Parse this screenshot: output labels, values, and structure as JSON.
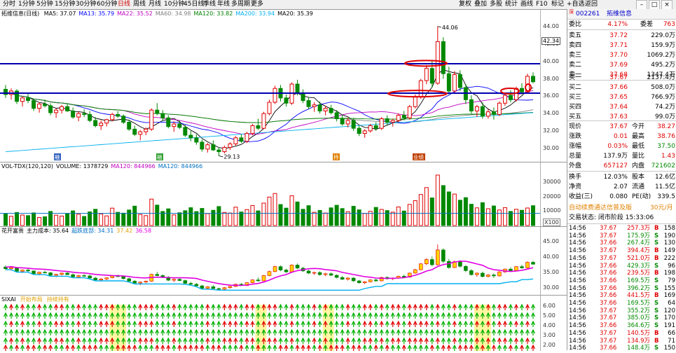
{
  "toolbar": {
    "periods": [
      "分时",
      "1分钟",
      "5分钟",
      "15分钟",
      "30分钟",
      "60分钟",
      "日线",
      "周线",
      "月线",
      "10分钟",
      "45日线",
      "季线",
      "年线",
      "多周期",
      "更多"
    ],
    "active_index": 6,
    "right_buttons": [
      "复权",
      "叠加",
      "多股",
      "统计",
      "画线",
      "F10",
      "标记",
      "+自选",
      "返回"
    ]
  },
  "kline": {
    "title": "拓维信息(日线)",
    "ma_labels": [
      "MA5: 37.07",
      "MA13: 35.79",
      "MA22: 35.52",
      "MA60: 34.98",
      "MA120: 33.82",
      "MA200: 33.94",
      "MA20: 35.39"
    ],
    "ma_colors": [
      "#000000",
      "#0000ff",
      "#c000c0",
      "#808080",
      "#008000",
      "#00b0f0",
      "#000000"
    ],
    "y_ticks": [
      "44.00",
      "42.00",
      "40.00",
      "38.00",
      "36.00",
      "34.00",
      "32.00",
      "30.00"
    ],
    "current_price_box": "42.34",
    "high_annotation": "44.06",
    "low_annotation": "29.13",
    "event_labels": [
      "融",
      "融",
      "持",
      "业绩"
    ]
  },
  "volume": {
    "title_items": [
      "VOL-TDX(120,120)",
      "VOLUME: 1378729",
      "MA120: 844966",
      "MA120: 844966"
    ],
    "y_ticks": [
      "30000",
      "20000",
      "10000"
    ],
    "unit": "X100"
  },
  "indicator1": {
    "title_items": [
      "花开富贵",
      "主力成本: 35.64",
      "超跌底部: 34.31",
      "37.42",
      "36.58"
    ],
    "y_ticks": [
      "45.00",
      "40.00",
      "35.00",
      "30.00"
    ]
  },
  "indicator2": {
    "title_items": [
      "SIXAI",
      "开始布局",
      "持续持有"
    ],
    "y_ticks": [
      "6.00",
      "5.00",
      "4.00",
      "3.00",
      "2.00"
    ]
  },
  "quote": {
    "code": "002261",
    "name": "拓维信息",
    "prefix": "深",
    "weibi": {
      "label": "委比",
      "value": "4.17%",
      "label2": "委差",
      "value2": "763"
    },
    "asks": [
      {
        "label": "卖五",
        "price": "37.72",
        "vol": "229.0万"
      },
      {
        "label": "卖四",
        "price": "37.71",
        "vol": "159.9万"
      },
      {
        "label": "卖三",
        "price": "37.70",
        "vol": "1069.2万"
      },
      {
        "label": "卖二",
        "price": "37.69",
        "vol": "495.2万"
      },
      {
        "label": "卖一",
        "price": "37.68",
        "vol": "1347.4万"
      }
    ],
    "bids": [
      {
        "label": "买一",
        "price": "37.67",
        "vol": "2137.4万"
      },
      {
        "label": "买二",
        "price": "37.66",
        "vol": "508.0万"
      },
      {
        "label": "买三",
        "price": "37.65",
        "vol": "766.9万"
      },
      {
        "label": "买四",
        "price": "37.64",
        "vol": "74.2万"
      },
      {
        "label": "买五",
        "price": "37.63",
        "vol": "99.0万"
      }
    ],
    "stats": [
      {
        "l1": "现价",
        "v1": "37.67",
        "l2": "今开",
        "v2": "38.27"
      },
      {
        "l1": "涨跌",
        "v1": "0.01",
        "l2": "最高",
        "v2": "38.76"
      },
      {
        "l1": "涨幅",
        "v1": "0.03%",
        "l2": "最低",
        "v2": "37.50"
      },
      {
        "l1": "总量",
        "v1": "137.9万",
        "l2": "量比",
        "v2": "1.43"
      },
      {
        "l1": "外盘",
        "v1": "657127",
        "l2": "内盘",
        "v2": "721602"
      }
    ],
    "stats2": [
      {
        "l1": "换手",
        "v1": "12.03%",
        "l2": "股本",
        "v2": "12.6亿"
      },
      {
        "l1": "净资",
        "v1": "2.07",
        "l2": "流通",
        "v2": "11.5亿"
      },
      {
        "l1": "收益(三)",
        "v1": "0.080",
        "l2": "PE(动)",
        "v2": "339.5"
      }
    ],
    "promo": "自动续费通达信普及版",
    "promo_price": "30元/月",
    "status": "交易状态: 闭市阶段 15:33:06",
    "trades": [
      {
        "t": "14:56",
        "p": "37.67",
        "v": "257.3万",
        "f": "B",
        "n": "158"
      },
      {
        "t": "14:56",
        "p": "37.67",
        "v": "175.9万",
        "f": "S",
        "n": "190"
      },
      {
        "t": "14:56",
        "p": "37.66",
        "v": "267.4万",
        "f": "S",
        "n": "130"
      },
      {
        "t": "14:56",
        "p": "37.67",
        "v": "394.4万",
        "f": "B",
        "n": "149"
      },
      {
        "t": "14:56",
        "p": "37.67",
        "v": "521.0万",
        "f": "B",
        "n": "222"
      },
      {
        "t": "14:56",
        "p": "37.66",
        "v": "429.3万",
        "f": "S",
        "n": "96"
      },
      {
        "t": "14:56",
        "p": "37.66",
        "v": "239.5万",
        "f": "B",
        "n": "198"
      },
      {
        "t": "14:56",
        "p": "37.66",
        "v": "169.5万",
        "f": "S",
        "n": "79"
      },
      {
        "t": "14:56",
        "p": "37.66",
        "v": "396.2万",
        "f": "S",
        "n": "155"
      },
      {
        "t": "14:56",
        "p": "37.66",
        "v": "441.5万",
        "f": "B",
        "n": "169"
      },
      {
        "t": "14:56",
        "p": "37.66",
        "v": "169.5万",
        "f": "S",
        "n": "64"
      },
      {
        "t": "14:56",
        "p": "37.67",
        "v": "355.2万",
        "f": "S",
        "n": "120"
      },
      {
        "t": "14:56",
        "p": "37.67",
        "v": "385.0万",
        "f": "S",
        "n": "170"
      },
      {
        "t": "14:56",
        "p": "37.66",
        "v": "364.6万",
        "f": "S",
        "n": "191"
      },
      {
        "t": "14:56",
        "p": "37.67",
        "v": "140.5万",
        "f": "B",
        "n": "66"
      },
      {
        "t": "14:56",
        "p": "37.67",
        "v": "134.9万",
        "f": "B",
        "n": "71"
      },
      {
        "t": "14:56",
        "p": "37.66",
        "v": "148.4万",
        "f": "S",
        "n": "150"
      }
    ]
  },
  "chart_data": [
    {
      "type": "candlestick",
      "title": "拓维信息(日线)",
      "ylim": [
        29,
        45
      ],
      "series": [
        {
          "name": "candles",
          "values": [
            [
              36.8,
              37.3,
              35.8,
              36.2
            ],
            [
              36.2,
              36.9,
              35.6,
              36.6
            ],
            [
              36.6,
              36.8,
              35.1,
              35.4
            ],
            [
              35.4,
              36.0,
              34.8,
              35.8
            ],
            [
              35.8,
              36.4,
              35.2,
              35.5
            ],
            [
              35.5,
              35.7,
              34.3,
              34.6
            ],
            [
              34.6,
              35.3,
              34.1,
              35.1
            ],
            [
              35.1,
              35.6,
              34.7,
              34.9
            ],
            [
              34.9,
              35.2,
              33.8,
              34.1
            ],
            [
              34.1,
              34.6,
              33.5,
              34.4
            ],
            [
              34.4,
              35.0,
              34.0,
              34.8
            ],
            [
              34.8,
              35.1,
              34.2,
              34.3
            ],
            [
              34.3,
              34.7,
              33.4,
              33.6
            ],
            [
              33.6,
              34.2,
              33.1,
              34.0
            ],
            [
              34.0,
              34.5,
              33.6,
              33.9
            ],
            [
              33.9,
              34.3,
              33.0,
              33.2
            ],
            [
              33.2,
              33.6,
              32.4,
              32.6
            ],
            [
              32.6,
              33.2,
              32.1,
              32.9
            ],
            [
              32.9,
              33.4,
              32.5,
              33.3
            ],
            [
              33.3,
              34.1,
              33.1,
              33.9
            ],
            [
              33.9,
              34.3,
              33.5,
              33.7
            ],
            [
              33.7,
              33.9,
              32.8,
              33.0
            ],
            [
              33.0,
              33.3,
              32.0,
              32.2
            ],
            [
              32.2,
              32.6,
              31.4,
              31.6
            ],
            [
              31.6,
              32.1,
              30.9,
              31.9
            ],
            [
              31.9,
              32.4,
              31.5,
              32.2
            ],
            [
              32.2,
              34.6,
              32.0,
              34.4
            ],
            [
              34.4,
              35.2,
              33.8,
              34.0
            ],
            [
              34.0,
              34.4,
              33.2,
              33.5
            ],
            [
              33.5,
              33.8,
              32.3,
              32.5
            ],
            [
              32.5,
              33.1,
              31.9,
              32.8
            ],
            [
              32.8,
              33.2,
              32.2,
              32.4
            ],
            [
              32.4,
              32.7,
              31.3,
              31.5
            ],
            [
              31.5,
              32.0,
              30.8,
              31.2
            ],
            [
              31.2,
              31.6,
              30.4,
              30.7
            ],
            [
              30.7,
              31.0,
              29.6,
              29.9
            ],
            [
              29.9,
              30.6,
              29.5,
              30.4
            ],
            [
              30.4,
              30.9,
              29.7,
              29.8
            ],
            [
              29.8,
              30.1,
              29.1,
              29.6
            ],
            [
              29.6,
              30.3,
              29.4,
              30.1
            ],
            [
              30.1,
              30.7,
              29.8,
              30.5
            ],
            [
              30.5,
              31.4,
              30.3,
              31.2
            ],
            [
              31.2,
              31.6,
              30.6,
              30.8
            ],
            [
              30.8,
              31.9,
              30.6,
              31.7
            ],
            [
              31.7,
              32.8,
              31.5,
              32.6
            ],
            [
              32.6,
              33.4,
              32.1,
              32.3
            ],
            [
              32.3,
              34.2,
              32.2,
              34.0
            ],
            [
              34.0,
              35.6,
              33.8,
              35.3
            ],
            [
              35.3,
              37.2,
              35.1,
              36.9
            ],
            [
              36.9,
              37.3,
              35.4,
              35.8
            ],
            [
              35.8,
              36.2,
              34.8,
              35.2
            ],
            [
              35.2,
              37.6,
              35.0,
              37.4
            ],
            [
              37.4,
              37.9,
              36.1,
              36.4
            ],
            [
              36.4,
              36.8,
              35.2,
              35.5
            ],
            [
              35.5,
              35.9,
              34.5,
              34.8
            ],
            [
              34.8,
              35.3,
              34.2,
              35.0
            ],
            [
              35.0,
              35.4,
              34.0,
              34.3
            ],
            [
              34.3,
              34.9,
              33.8,
              34.6
            ],
            [
              34.6,
              35.0,
              33.9,
              34.1
            ],
            [
              34.1,
              34.4,
              33.1,
              33.4
            ],
            [
              33.4,
              33.9,
              32.6,
              32.8
            ],
            [
              32.8,
              33.5,
              32.4,
              33.2
            ],
            [
              33.2,
              33.5,
              32.0,
              32.3
            ],
            [
              32.3,
              32.6,
              31.4,
              31.7
            ],
            [
              31.7,
              32.2,
              31.2,
              32.0
            ],
            [
              32.0,
              32.8,
              31.8,
              32.6
            ],
            [
              32.6,
              33.0,
              32.0,
              32.3
            ],
            [
              32.3,
              33.6,
              32.1,
              33.4
            ],
            [
              33.4,
              33.8,
              32.7,
              33.0
            ],
            [
              33.0,
              33.4,
              32.5,
              33.2
            ],
            [
              33.2,
              34.0,
              33.0,
              33.8
            ],
            [
              33.8,
              34.3,
              33.2,
              33.5
            ],
            [
              33.5,
              35.0,
              33.3,
              34.8
            ],
            [
              34.8,
              36.2,
              34.6,
              35.9
            ],
            [
              35.9,
              38.0,
              35.7,
              37.8
            ],
            [
              37.8,
              39.6,
              37.4,
              39.2
            ],
            [
              39.2,
              40.2,
              37.0,
              37.5
            ],
            [
              37.5,
              44.06,
              37.3,
              42.3
            ],
            [
              42.3,
              42.8,
              38.0,
              38.6
            ],
            [
              38.6,
              39.4,
              36.2,
              36.6
            ],
            [
              36.6,
              38.9,
              36.4,
              38.5
            ],
            [
              38.5,
              39.0,
              36.6,
              37.0
            ],
            [
              37.0,
              37.4,
              35.1,
              35.6
            ],
            [
              35.6,
              36.1,
              34.0,
              34.3
            ],
            [
              34.3,
              35.0,
              33.6,
              34.8
            ],
            [
              34.8,
              35.3,
              33.4,
              33.7
            ],
            [
              33.7,
              34.5,
              33.4,
              34.2
            ],
            [
              34.2,
              34.7,
              33.3,
              33.9
            ],
            [
              33.9,
              35.4,
              33.7,
              35.2
            ],
            [
              35.2,
              36.3,
              34.9,
              36.1
            ],
            [
              36.1,
              36.7,
              35.3,
              35.6
            ],
            [
              35.6,
              37.1,
              35.4,
              36.9
            ],
            [
              36.9,
              37.5,
              36.2,
              36.5
            ],
            [
              36.5,
              38.6,
              36.3,
              38.3
            ],
            [
              38.3,
              38.76,
              37.5,
              37.67
            ]
          ]
        }
      ]
    },
    {
      "type": "bar",
      "title": "VOL-TDX(120,120)",
      "ylim": [
        0,
        38000
      ],
      "values": [
        8200,
        6400,
        9100,
        7300,
        6900,
        8800,
        5600,
        6100,
        9800,
        7200,
        6600,
        8400,
        10200,
        7900,
        6300,
        9500,
        11300,
        8100,
        6700,
        12100,
        9200,
        8600,
        10800,
        13500,
        7700,
        6900,
        18400,
        14200,
        9800,
        11600,
        7400,
        8900,
        10300,
        12400,
        9700,
        11900,
        8300,
        10600,
        13200,
        9100,
        8700,
        12800,
        9400,
        11100,
        13900,
        10200,
        15600,
        19800,
        22300,
        14600,
        12100,
        20700,
        16400,
        11300,
        13800,
        9200,
        10500,
        8700,
        12300,
        14100,
        11800,
        9600,
        13400,
        10900,
        8400,
        9900,
        12600,
        11200,
        10400,
        9300,
        12900,
        10100,
        14700,
        17300,
        21600,
        26400,
        19200,
        35100,
        27800,
        23400,
        21900,
        17600,
        19400,
        14800,
        12300,
        15900,
        11700,
        13600,
        10800,
        12400,
        9800,
        11300,
        10600,
        12200,
        13787
      ],
      "ma120": 8450
    }
  ]
}
